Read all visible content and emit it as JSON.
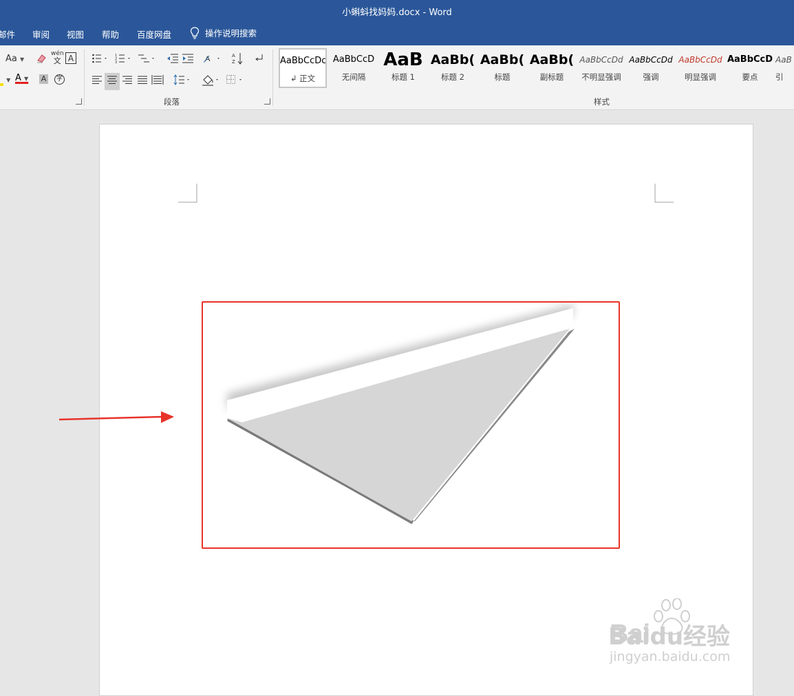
{
  "window": {
    "title": "小蝌蚪找妈妈.docx  -  Word"
  },
  "menu": {
    "tabs": [
      "邮件",
      "审阅",
      "视图",
      "帮助",
      "百度网盘"
    ],
    "tell_me": "操作说明搜索"
  },
  "ribbon": {
    "font_group": {
      "change_case": "Aa",
      "phonetic_top": "wén",
      "phonetic_bottom": "文",
      "border_char": "A",
      "font_color": "A",
      "shade_char": "A",
      "enclose_char": "字"
    },
    "paragraph_group": {
      "label": "段落"
    },
    "styles_group": {
      "label": "样式",
      "items": [
        {
          "sample": "AaBbCcDc",
          "name": "↲ 正文"
        },
        {
          "sample": "AaBbCcD",
          "name": "无间隔"
        },
        {
          "sample": "AaB",
          "name": "标题 1"
        },
        {
          "sample": "AaBb(",
          "name": "标题 2"
        },
        {
          "sample": "AaBb(",
          "name": "标题"
        },
        {
          "sample": "AaBb(",
          "name": "副标题"
        },
        {
          "sample": "AaBbCcDd",
          "name": "不明显强调"
        },
        {
          "sample": "AaBbCcDd",
          "name": "强调"
        },
        {
          "sample": "AaBbCcDd",
          "name": "明显强调"
        },
        {
          "sample": "AaBbCcD",
          "name": "要点"
        },
        {
          "sample": "AaB",
          "name": "引"
        }
      ]
    }
  },
  "colors": {
    "title_bar": "#2b579a",
    "highlight": "#e8332a",
    "shape_fill": "#d6d6d6",
    "shape_edge": "#8a8a8a",
    "font_color_underline": "#e0201b",
    "highlighter_yellow": "#f5e100"
  },
  "watermark": {
    "logo": "Baidu经验",
    "url": "jingyan.baidu.com"
  }
}
